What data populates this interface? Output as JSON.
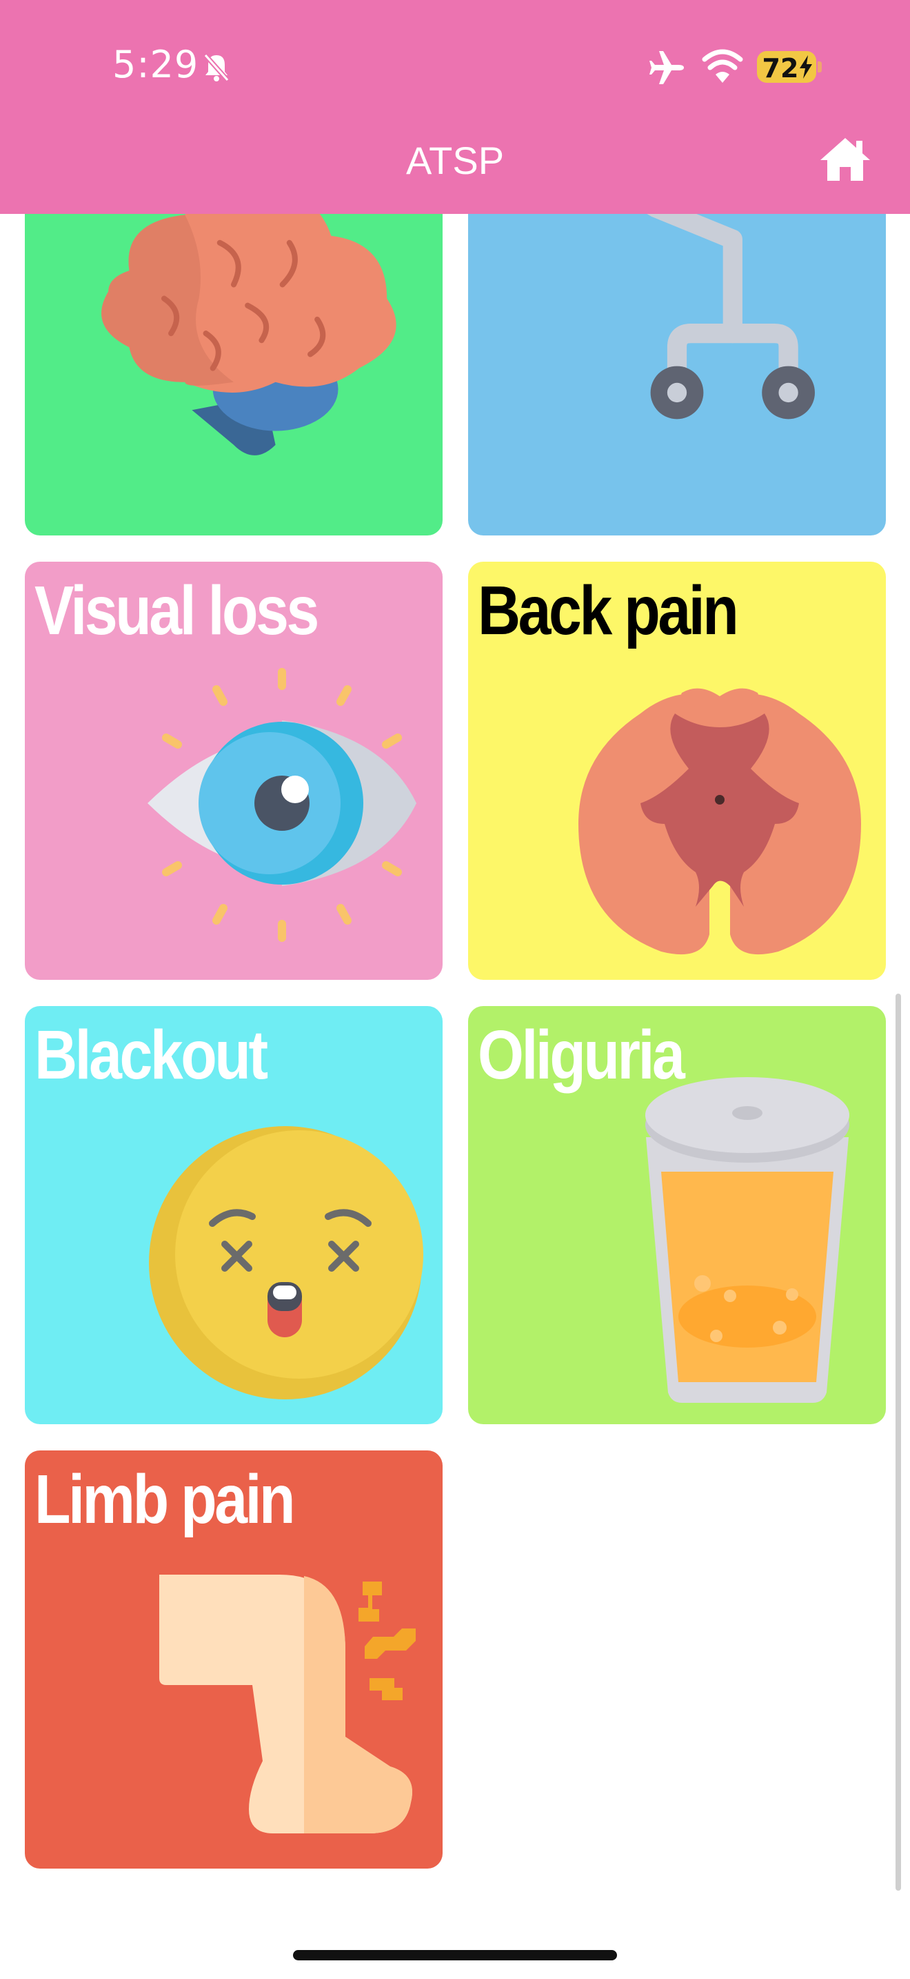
{
  "status_bar": {
    "time": "5:29",
    "battery": "72",
    "icons": [
      "bell-slash-icon",
      "airplane-icon",
      "wifi-icon",
      "battery-icon",
      "bolt-icon"
    ]
  },
  "nav": {
    "title": "ATSP",
    "home_icon": "home-icon"
  },
  "tiles": [
    {
      "label": "",
      "icon": "brain-icon",
      "color": "#52ec88"
    },
    {
      "label": "",
      "icon": "walker-icon",
      "color": "#77c3ec"
    },
    {
      "label": "Visual loss",
      "icon": "eye-icon",
      "color": "#f29dc8",
      "label_color": "#ffffff"
    },
    {
      "label": "Back pain",
      "icon": "spinal-cord-icon",
      "color": "#fdf768",
      "label_color": "#000000"
    },
    {
      "label": "Blackout",
      "icon": "dizzy-face-icon",
      "color": "#6fedf3",
      "label_color": "#ffffff"
    },
    {
      "label": "Oliguria",
      "icon": "urine-cup-icon",
      "color": "#b2f169",
      "label_color": "#ffffff"
    },
    {
      "label": "Limb pain",
      "icon": "leg-pain-icon",
      "color": "#ea614a",
      "label_color": "#ffffff"
    }
  ],
  "colors": {
    "header": "#ec73b0",
    "background": "#ffffff"
  }
}
